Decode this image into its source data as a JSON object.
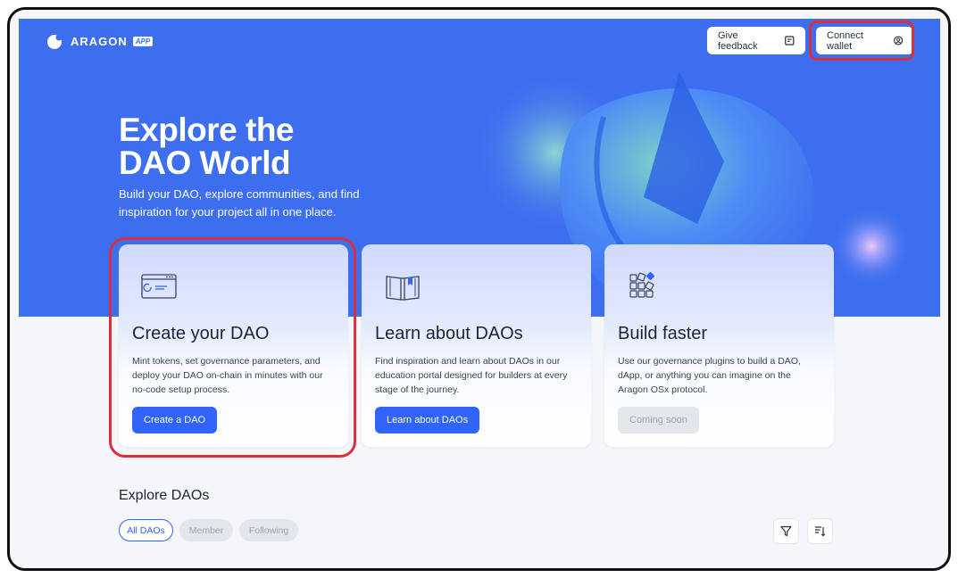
{
  "header": {
    "logo_text": "ARAGON",
    "logo_badge": "APP",
    "feedback_label": "Give feedback",
    "connect_label": "Connect wallet"
  },
  "hero": {
    "title_line1": "Explore the",
    "title_line2": "DAO World",
    "subtitle": "Build your DAO, explore communities, and find inspiration for your project all in one place."
  },
  "cards": [
    {
      "title": "Create your DAO",
      "description": "Mint tokens, set governance parameters, and deploy your DAO on-chain in minutes with our no-code setup process.",
      "button": "Create a DAO",
      "icon": "browser-window-icon"
    },
    {
      "title": "Learn about DAOs",
      "description": "Find inspiration and learn about DAOs in our education portal designed for builders at every stage of the journey.",
      "button": "Learn about DAOs",
      "icon": "book-icon"
    },
    {
      "title": "Build faster",
      "description": "Use our governance plugins to build a DAO, dApp, or anything you can imagine on the Aragon OSx protocol.",
      "button": "Coming soon",
      "icon": "blocks-icon"
    }
  ],
  "explore": {
    "title": "Explore DAOs",
    "filters": [
      "All DAOs",
      "Member",
      "Following"
    ]
  },
  "colors": {
    "hero_bg": "#3d6ef0",
    "primary": "#3164fa",
    "highlight": "#d9313b"
  }
}
